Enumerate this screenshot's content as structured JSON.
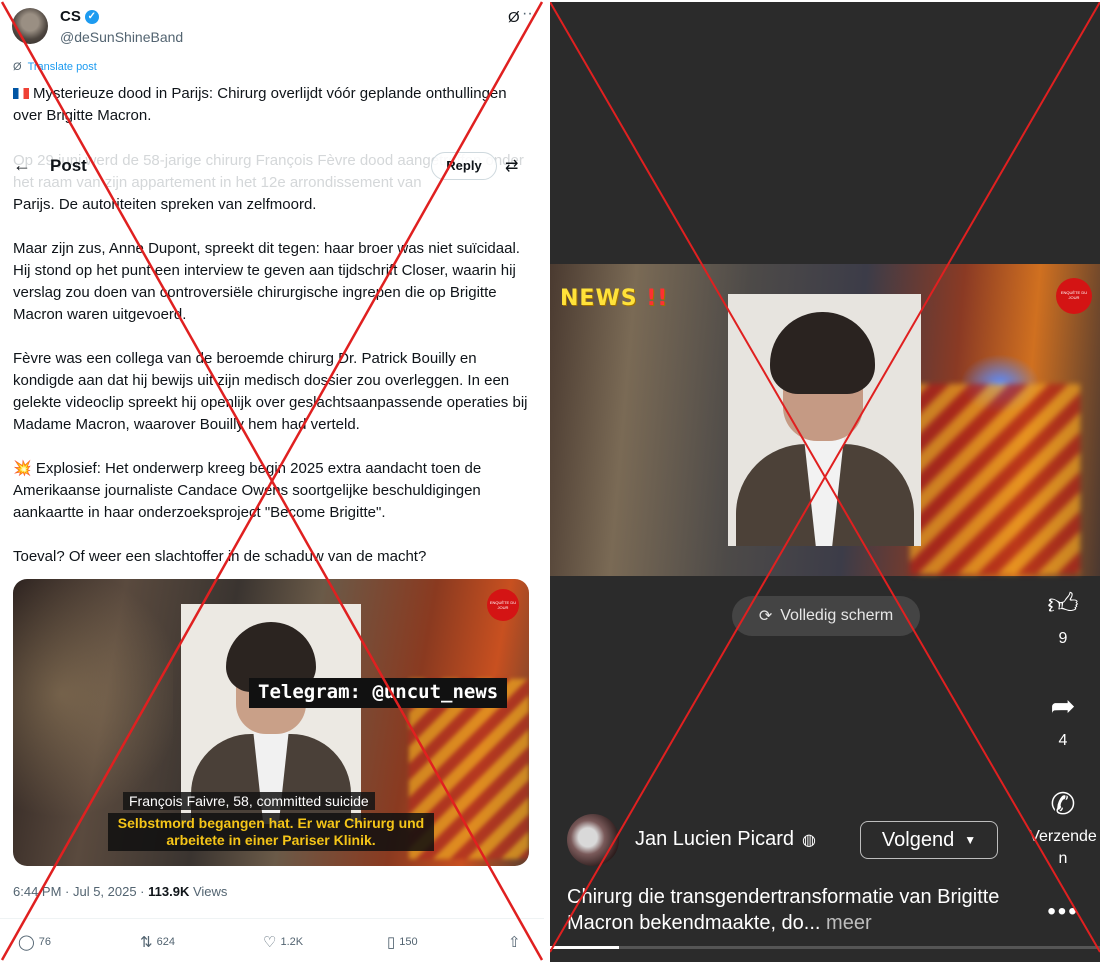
{
  "tweet": {
    "author_name": "CS",
    "handle": "@deSunShineBand",
    "translate_label": "Translate post",
    "header_title": "Post",
    "reply_label": "Reply",
    "para1": "Mysterieuze dood in Parijs: Chirurg overlijdt vóór geplande onthullingen over Brigitte Macron.",
    "para2a_faded": "Op 29 juni werd de 58-jarige chirurg François Fèvre dood aangetroffen onder het raam van zijn appartement in het 12e arrondissement van",
    "para2b": "Parijs. De autoriteiten spreken van zelfmoord.",
    "para3": "Maar zijn zus, Anne Dupont, spreekt dit tegen: haar broer was niet suïcidaal. Hij stond op het punt een interview te geven aan tijdschrift Closer, waarin hij verslag zou doen van controversiële chirurgische ingrepen die op Brigitte Macron waren uitgevoerd.",
    "para4": "Fèvre was een collega van de beroemde chirurg Dr. Patrick Bouilly en kondigde aan dat hij bewijs uit zijn medisch dossier zou overleggen. In een gelekte videoclip spreekt hij openlijk over geslachtsaanpassende operaties bij Madame Macron, waarover Bouilly hem had verteld.",
    "para5_emoji": "💥",
    "para5": "Explosief: Het onderwerp kreeg begin 2025 extra aandacht toen de Amerikaanse journaliste Candace Owens soortgelijke beschuldigingen aankaartte in haar onderzoeksproject \"Become Brigitte\".",
    "para6": "Toeval? Of weer een slachtoffer in de schaduw van de macht?",
    "media_telegram": "Telegram: @uncut_news",
    "media_caption1": "François Faivre, 58, committed suicide",
    "media_caption2": "Selbstmord begangen hat. Er war Chirurg und arbeitete in einer Pariser Klinik.",
    "media_badge": "ENQUÊTE DU JOUR",
    "time": "6:44 PM · Jul 5, 2025 · ",
    "views": "113.9K",
    "views_label": " Views",
    "replies": "76",
    "reposts": "624",
    "likes": "1.2K",
    "bookmarks": "150"
  },
  "video": {
    "overlay_news": "NEWS",
    "overlay_exclaim": "!!",
    "badge": "ENQUÊTE DU JOUR",
    "fullscreen_label": "Volledig scherm",
    "likes_count": "9",
    "shares_count": "4",
    "send_label": "Verzenden",
    "page_name": "Jan Lucien Picard",
    "follow_label": "Volgend",
    "description": "Chirurg die transgendertransformatie van Brigitte Macron bekendmaakte, do...",
    "more_label": " meer",
    "progress_fraction": 0.125
  },
  "icons": {
    "verified": "verified-badge-icon",
    "grok": "grok-icon",
    "more": "more-icon",
    "back": "back-arrow-icon",
    "filter": "filter-icon",
    "reply": "reply-icon",
    "repost": "repost-icon",
    "like": "heart-icon",
    "bookmark": "bookmark-icon",
    "share": "share-icon",
    "thumbs_up": "thumbs-up-icon",
    "fb_share": "share-arrow-icon",
    "whatsapp": "whatsapp-icon",
    "globe": "globe-icon",
    "caret": "caret-down-icon",
    "fullscreen": "fullscreen-icon"
  },
  "colors": {
    "x_blue": "#1d9bf0",
    "cross_red": "#e02020",
    "fb_bg": "#2b2b2b"
  }
}
